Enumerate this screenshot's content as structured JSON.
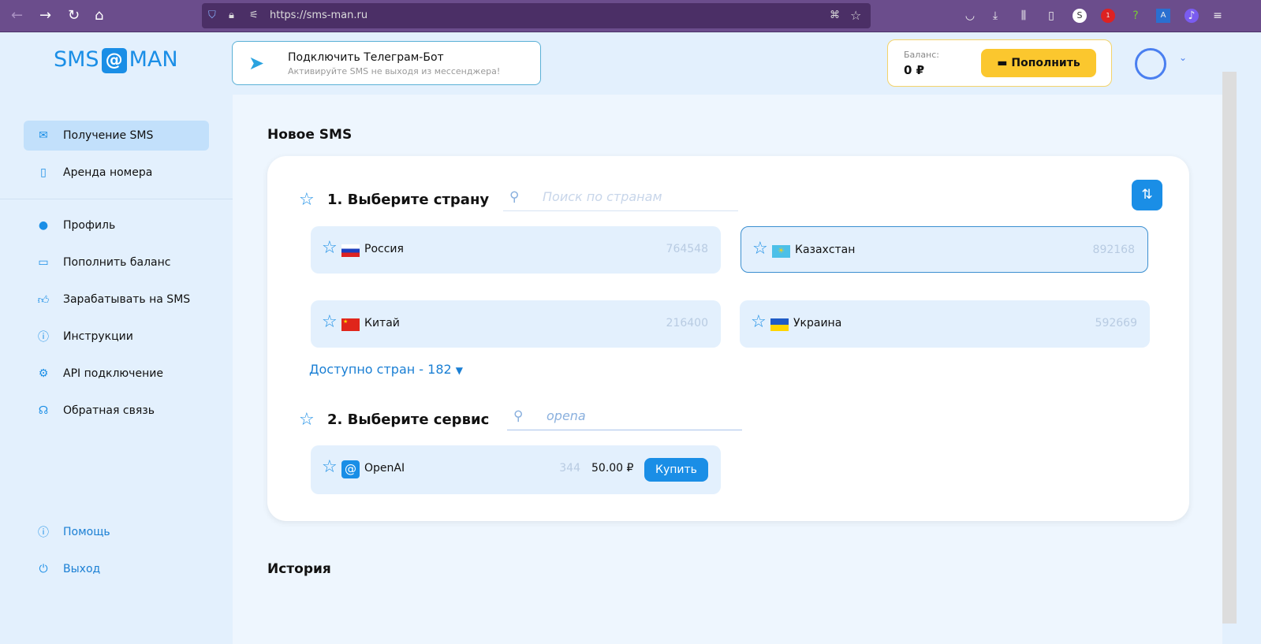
{
  "browser": {
    "url": "https://sms-man.ru",
    "badge_abp": "1",
    "badge_ext": "?"
  },
  "logo": {
    "left": "SMS",
    "mark": "@",
    "right": "MAN"
  },
  "telegram": {
    "title": "Подключить Телеграм-Бот",
    "subtitle": "Активируйте SMS не выходя из мессенджера!"
  },
  "balance": {
    "label": "Баланс:",
    "value": "0 ₽",
    "topup": "Пополнить"
  },
  "sidebar": {
    "items": [
      {
        "label": "Получение SMS"
      },
      {
        "label": "Аренда номера"
      },
      {
        "label": "Профиль"
      },
      {
        "label": "Пополнить баланс"
      },
      {
        "label": "Зарабатывать на SMS"
      },
      {
        "label": "Инструкции"
      },
      {
        "label": "API подключение"
      },
      {
        "label": "Обратная связь"
      },
      {
        "label": "Помощь"
      },
      {
        "label": "Выход"
      }
    ]
  },
  "main": {
    "title": "Новое SMS",
    "step1": "1. Выберите страну",
    "country_search_placeholder": "Поиск по странам",
    "countries": [
      {
        "name": "Россия",
        "count": "764548"
      },
      {
        "name": "Казахстан",
        "count": "892168"
      },
      {
        "name": "Китай",
        "count": "216400"
      },
      {
        "name": "Украина",
        "count": "592669"
      }
    ],
    "more_countries": "Доступно стран - 182",
    "step2": "2. Выберите сервис",
    "service_search_value": "opena",
    "services": [
      {
        "name": "OpenAI",
        "count": "344",
        "price": "50.00 ₽",
        "buy": "Купить"
      }
    ],
    "history_title": "История"
  }
}
